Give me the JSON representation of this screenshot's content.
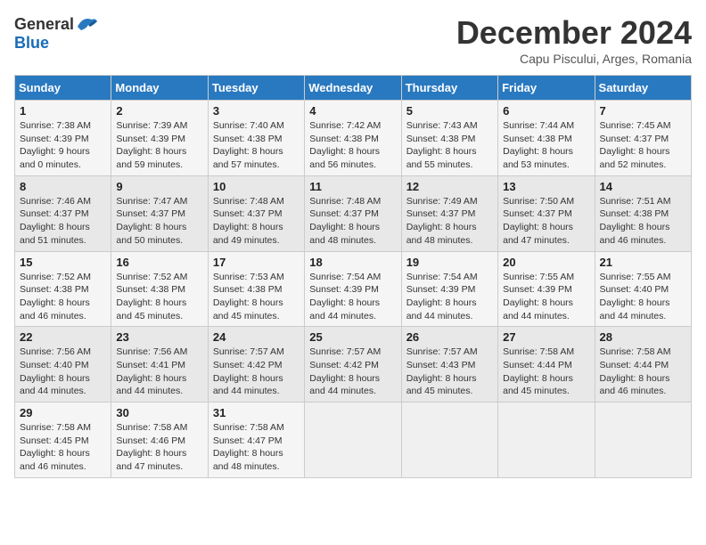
{
  "header": {
    "logo_general": "General",
    "logo_blue": "Blue",
    "month_title": "December 2024",
    "subtitle": "Capu Piscului, Arges, Romania"
  },
  "days_of_week": [
    "Sunday",
    "Monday",
    "Tuesday",
    "Wednesday",
    "Thursday",
    "Friday",
    "Saturday"
  ],
  "weeks": [
    [
      {
        "day": "1",
        "sunrise": "7:38 AM",
        "sunset": "4:39 PM",
        "daylight": "9 hours and 0 minutes."
      },
      {
        "day": "2",
        "sunrise": "7:39 AM",
        "sunset": "4:39 PM",
        "daylight": "8 hours and 59 minutes."
      },
      {
        "day": "3",
        "sunrise": "7:40 AM",
        "sunset": "4:38 PM",
        "daylight": "8 hours and 57 minutes."
      },
      {
        "day": "4",
        "sunrise": "7:42 AM",
        "sunset": "4:38 PM",
        "daylight": "8 hours and 56 minutes."
      },
      {
        "day": "5",
        "sunrise": "7:43 AM",
        "sunset": "4:38 PM",
        "daylight": "8 hours and 55 minutes."
      },
      {
        "day": "6",
        "sunrise": "7:44 AM",
        "sunset": "4:38 PM",
        "daylight": "8 hours and 53 minutes."
      },
      {
        "day": "7",
        "sunrise": "7:45 AM",
        "sunset": "4:37 PM",
        "daylight": "8 hours and 52 minutes."
      }
    ],
    [
      {
        "day": "8",
        "sunrise": "7:46 AM",
        "sunset": "4:37 PM",
        "daylight": "8 hours and 51 minutes."
      },
      {
        "day": "9",
        "sunrise": "7:47 AM",
        "sunset": "4:37 PM",
        "daylight": "8 hours and 50 minutes."
      },
      {
        "day": "10",
        "sunrise": "7:48 AM",
        "sunset": "4:37 PM",
        "daylight": "8 hours and 49 minutes."
      },
      {
        "day": "11",
        "sunrise": "7:48 AM",
        "sunset": "4:37 PM",
        "daylight": "8 hours and 48 minutes."
      },
      {
        "day": "12",
        "sunrise": "7:49 AM",
        "sunset": "4:37 PM",
        "daylight": "8 hours and 48 minutes."
      },
      {
        "day": "13",
        "sunrise": "7:50 AM",
        "sunset": "4:37 PM",
        "daylight": "8 hours and 47 minutes."
      },
      {
        "day": "14",
        "sunrise": "7:51 AM",
        "sunset": "4:38 PM",
        "daylight": "8 hours and 46 minutes."
      }
    ],
    [
      {
        "day": "15",
        "sunrise": "7:52 AM",
        "sunset": "4:38 PM",
        "daylight": "8 hours and 46 minutes."
      },
      {
        "day": "16",
        "sunrise": "7:52 AM",
        "sunset": "4:38 PM",
        "daylight": "8 hours and 45 minutes."
      },
      {
        "day": "17",
        "sunrise": "7:53 AM",
        "sunset": "4:38 PM",
        "daylight": "8 hours and 45 minutes."
      },
      {
        "day": "18",
        "sunrise": "7:54 AM",
        "sunset": "4:39 PM",
        "daylight": "8 hours and 44 minutes."
      },
      {
        "day": "19",
        "sunrise": "7:54 AM",
        "sunset": "4:39 PM",
        "daylight": "8 hours and 44 minutes."
      },
      {
        "day": "20",
        "sunrise": "7:55 AM",
        "sunset": "4:39 PM",
        "daylight": "8 hours and 44 minutes."
      },
      {
        "day": "21",
        "sunrise": "7:55 AM",
        "sunset": "4:40 PM",
        "daylight": "8 hours and 44 minutes."
      }
    ],
    [
      {
        "day": "22",
        "sunrise": "7:56 AM",
        "sunset": "4:40 PM",
        "daylight": "8 hours and 44 minutes."
      },
      {
        "day": "23",
        "sunrise": "7:56 AM",
        "sunset": "4:41 PM",
        "daylight": "8 hours and 44 minutes."
      },
      {
        "day": "24",
        "sunrise": "7:57 AM",
        "sunset": "4:42 PM",
        "daylight": "8 hours and 44 minutes."
      },
      {
        "day": "25",
        "sunrise": "7:57 AM",
        "sunset": "4:42 PM",
        "daylight": "8 hours and 44 minutes."
      },
      {
        "day": "26",
        "sunrise": "7:57 AM",
        "sunset": "4:43 PM",
        "daylight": "8 hours and 45 minutes."
      },
      {
        "day": "27",
        "sunrise": "7:58 AM",
        "sunset": "4:44 PM",
        "daylight": "8 hours and 45 minutes."
      },
      {
        "day": "28",
        "sunrise": "7:58 AM",
        "sunset": "4:44 PM",
        "daylight": "8 hours and 46 minutes."
      }
    ],
    [
      {
        "day": "29",
        "sunrise": "7:58 AM",
        "sunset": "4:45 PM",
        "daylight": "8 hours and 46 minutes."
      },
      {
        "day": "30",
        "sunrise": "7:58 AM",
        "sunset": "4:46 PM",
        "daylight": "8 hours and 47 minutes."
      },
      {
        "day": "31",
        "sunrise": "7:58 AM",
        "sunset": "4:47 PM",
        "daylight": "8 hours and 48 minutes."
      },
      null,
      null,
      null,
      null
    ]
  ],
  "labels": {
    "sunrise": "Sunrise:",
    "sunset": "Sunset:",
    "daylight": "Daylight:"
  }
}
